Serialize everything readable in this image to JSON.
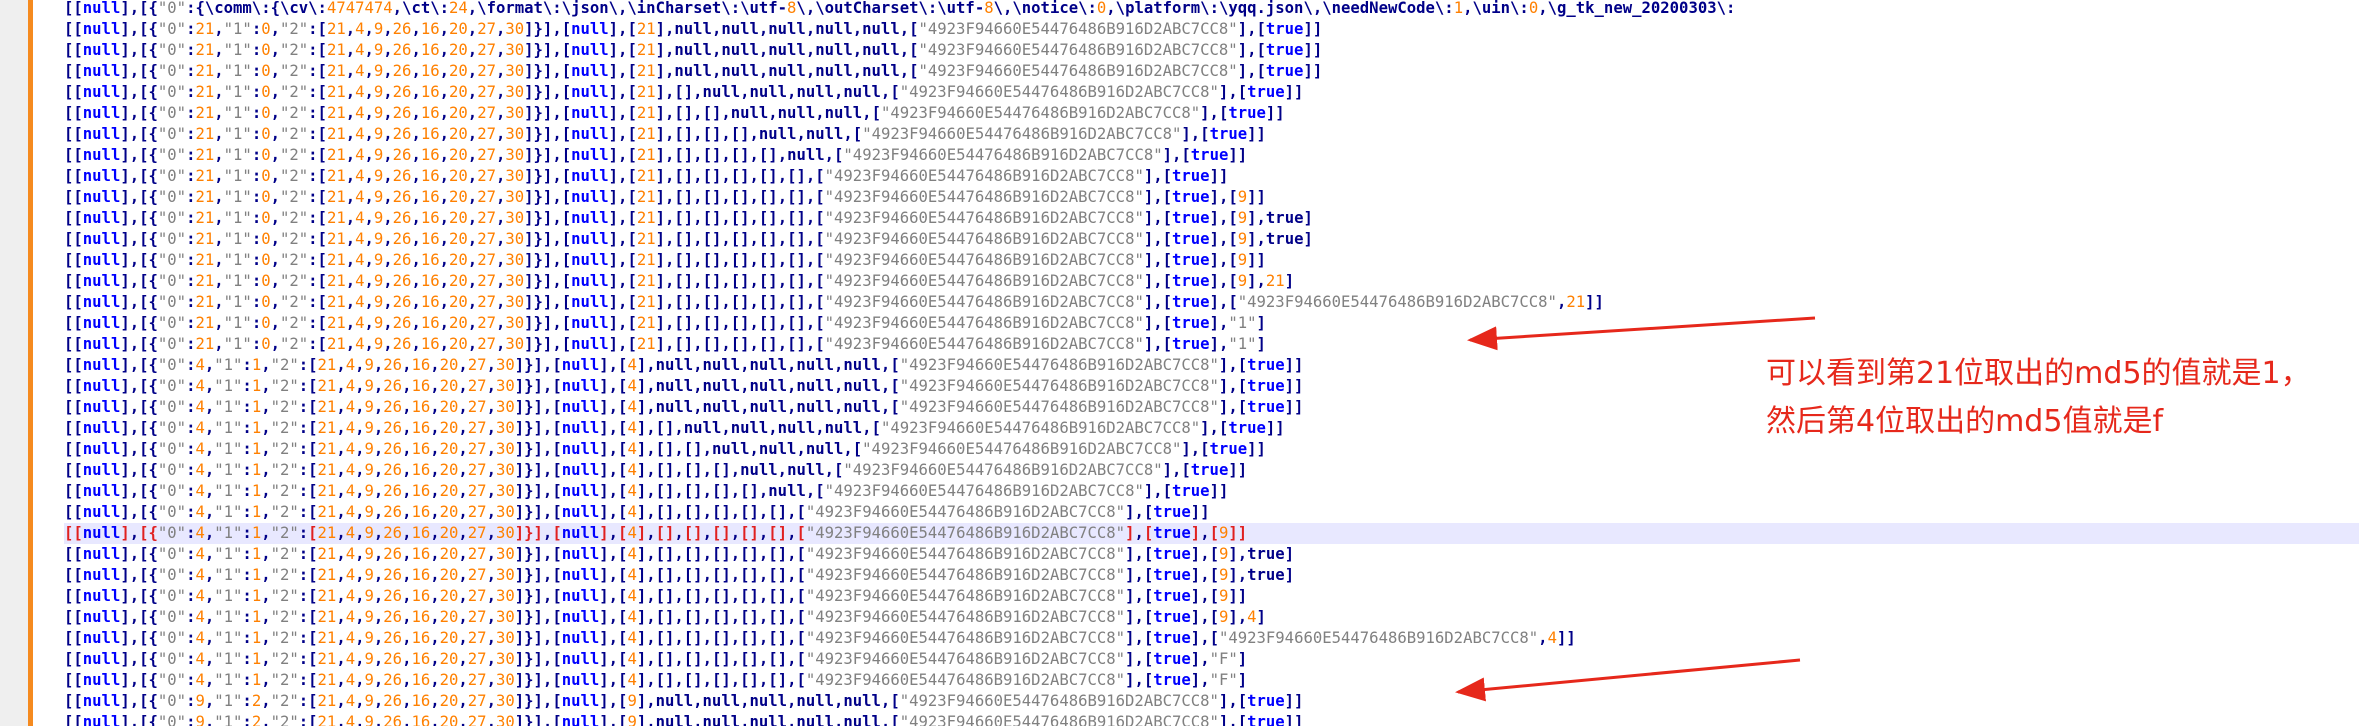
{
  "editor": {
    "lines": [
      "[[null],[{\"0\":\"{\\\"comm\\\":{\\\"cv\\\":4747474,\\\"ct\\\":24,\\\"format\\\":\\\"json\\\",\\\"inCharset\\\":\\\"utf-8\\\",\\\"outCharset\\\":\\\"utf-8\\\",\\\"notice\\\":0,\\\"platform\\\":\\\"yqq.json\\\",\\\"needNewCode\\\":1,\\\"uin\\\":0,\\\"g_tk_new_20200303\\\":",
      "[[null],[{\"0\":21,\"1\":0,\"2\":[21,4,9,26,16,20,27,30]}],[null],[21],null,null,null,null,null,[\"4923F94660E54476486B916D2ABC7CC8\"],[true]]",
      "[[null],[{\"0\":21,\"1\":0,\"2\":[21,4,9,26,16,20,27,30]}],[null],[21],null,null,null,null,null,[\"4923F94660E54476486B916D2ABC7CC8\"],[true]]",
      "[[null],[{\"0\":21,\"1\":0,\"2\":[21,4,9,26,16,20,27,30]}],[null],[21],null,null,null,null,null,[\"4923F94660E54476486B916D2ABC7CC8\"],[true]]",
      "[[null],[{\"0\":21,\"1\":0,\"2\":[21,4,9,26,16,20,27,30]}],[null],[21],[],null,null,null,null,[\"4923F94660E54476486B916D2ABC7CC8\"],[true]]",
      "[[null],[{\"0\":21,\"1\":0,\"2\":[21,4,9,26,16,20,27,30]}],[null],[21],[],[],null,null,null,[\"4923F94660E54476486B916D2ABC7CC8\"],[true]]",
      "[[null],[{\"0\":21,\"1\":0,\"2\":[21,4,9,26,16,20,27,30]}],[null],[21],[],[],[],null,null,[\"4923F94660E54476486B916D2ABC7CC8\"],[true]]",
      "[[null],[{\"0\":21,\"1\":0,\"2\":[21,4,9,26,16,20,27,30]}],[null],[21],[],[],[],[],null,[\"4923F94660E54476486B916D2ABC7CC8\"],[true]]",
      "[[null],[{\"0\":21,\"1\":0,\"2\":[21,4,9,26,16,20,27,30]}],[null],[21],[],[],[],[],[],[\"4923F94660E54476486B916D2ABC7CC8\"],[true]]",
      "[[null],[{\"0\":21,\"1\":0,\"2\":[21,4,9,26,16,20,27,30]}],[null],[21],[],[],[],[],[],[\"4923F94660E54476486B916D2ABC7CC8\"],[true],[9]]",
      "[[null],[{\"0\":21,\"1\":0,\"2\":[21,4,9,26,16,20,27,30]}],[null],[21],[],[],[],[],[],[\"4923F94660E54476486B916D2ABC7CC8\"],[true],[9],true]",
      "[[null],[{\"0\":21,\"1\":0,\"2\":[21,4,9,26,16,20,27,30]}],[null],[21],[],[],[],[],[],[\"4923F94660E54476486B916D2ABC7CC8\"],[true],[9],true]",
      "[[null],[{\"0\":21,\"1\":0,\"2\":[21,4,9,26,16,20,27,30]}],[null],[21],[],[],[],[],[],[\"4923F94660E54476486B916D2ABC7CC8\"],[true],[9]]",
      "[[null],[{\"0\":21,\"1\":0,\"2\":[21,4,9,26,16,20,27,30]}],[null],[21],[],[],[],[],[],[\"4923F94660E54476486B916D2ABC7CC8\"],[true],[9],21]",
      "[[null],[{\"0\":21,\"1\":0,\"2\":[21,4,9,26,16,20,27,30]}],[null],[21],[],[],[],[],[],[\"4923F94660E54476486B916D2ABC7CC8\"],[true],[\"4923F94660E54476486B916D2ABC7CC8\",21]]",
      "[[null],[{\"0\":21,\"1\":0,\"2\":[21,4,9,26,16,20,27,30]}],[null],[21],[],[],[],[],[],[\"4923F94660E54476486B916D2ABC7CC8\"],[true],\"1\"]",
      "[[null],[{\"0\":21,\"1\":0,\"2\":[21,4,9,26,16,20,27,30]}],[null],[21],[],[],[],[],[],[\"4923F94660E54476486B916D2ABC7CC8\"],[true],\"1\"]",
      "[[null],[{\"0\":4,\"1\":1,\"2\":[21,4,9,26,16,20,27,30]}],[null],[4],null,null,null,null,null,[\"4923F94660E54476486B916D2ABC7CC8\"],[true]]",
      "[[null],[{\"0\":4,\"1\":1,\"2\":[21,4,9,26,16,20,27,30]}],[null],[4],null,null,null,null,null,[\"4923F94660E54476486B916D2ABC7CC8\"],[true]]",
      "[[null],[{\"0\":4,\"1\":1,\"2\":[21,4,9,26,16,20,27,30]}],[null],[4],null,null,null,null,null,[\"4923F94660E54476486B916D2ABC7CC8\"],[true]]",
      "[[null],[{\"0\":4,\"1\":1,\"2\":[21,4,9,26,16,20,27,30]}],[null],[4],[],null,null,null,null,[\"4923F94660E54476486B916D2ABC7CC8\"],[true]]",
      "[[null],[{\"0\":4,\"1\":1,\"2\":[21,4,9,26,16,20,27,30]}],[null],[4],[],[],null,null,null,[\"4923F94660E54476486B916D2ABC7CC8\"],[true]]",
      "[[null],[{\"0\":4,\"1\":1,\"2\":[21,4,9,26,16,20,27,30]}],[null],[4],[],[],[],null,null,[\"4923F94660E54476486B916D2ABC7CC8\"],[true]]",
      "[[null],[{\"0\":4,\"1\":1,\"2\":[21,4,9,26,16,20,27,30]}],[null],[4],[],[],[],[],null,[\"4923F94660E54476486B916D2ABC7CC8\"],[true]]",
      "[[null],[{\"0\":4,\"1\":1,\"2\":[21,4,9,26,16,20,27,30]}],[null],[4],[],[],[],[],[],[\"4923F94660E54476486B916D2ABC7CC8\"],[true]]",
      "[[null],[{\"0\":4,\"1\":1,\"2\":[21,4,9,26,16,20,27,30]}],[null],[4],[],[],[],[],[],[\"4923F94660E54476486B916D2ABC7CC8\"],[true],[9]]",
      "[[null],[{\"0\":4,\"1\":1,\"2\":[21,4,9,26,16,20,27,30]}],[null],[4],[],[],[],[],[],[\"4923F94660E54476486B916D2ABC7CC8\"],[true],[9],true]",
      "[[null],[{\"0\":4,\"1\":1,\"2\":[21,4,9,26,16,20,27,30]}],[null],[4],[],[],[],[],[],[\"4923F94660E54476486B916D2ABC7CC8\"],[true],[9],true]",
      "[[null],[{\"0\":4,\"1\":1,\"2\":[21,4,9,26,16,20,27,30]}],[null],[4],[],[],[],[],[],[\"4923F94660E54476486B916D2ABC7CC8\"],[true],[9]]",
      "[[null],[{\"0\":4,\"1\":1,\"2\":[21,4,9,26,16,20,27,30]}],[null],[4],[],[],[],[],[],[\"4923F94660E54476486B916D2ABC7CC8\"],[true],[9],4]",
      "[[null],[{\"0\":4,\"1\":1,\"2\":[21,4,9,26,16,20,27,30]}],[null],[4],[],[],[],[],[],[\"4923F94660E54476486B916D2ABC7CC8\"],[true],[\"4923F94660E54476486B916D2ABC7CC8\",4]]",
      "[[null],[{\"0\":4,\"1\":1,\"2\":[21,4,9,26,16,20,27,30]}],[null],[4],[],[],[],[],[],[\"4923F94660E54476486B916D2ABC7CC8\"],[true],\"F\"]",
      "[[null],[{\"0\":4,\"1\":1,\"2\":[21,4,9,26,16,20,27,30]}],[null],[4],[],[],[],[],[],[\"4923F94660E54476486B916D2ABC7CC8\"],[true],\"F\"]",
      "[[null],[{\"0\":9,\"1\":2,\"2\":[21,4,9,26,16,20,27,30]}],[null],[9],null,null,null,null,null,[\"4923F94660E54476486B916D2ABC7CC8\"],[true]]",
      "[[null],[{\"0\":9,\"1\":2,\"2\":[21,4,9,26,16,20,27,30]}],[null],[9],null,null,null,null,null,[\"4923F94660E54476486B916D2ABC7CC8\"],[true]]"
    ],
    "current_line_index": 25
  },
  "annotation": {
    "line1": "可以看到第21位取出的md5的值就是1，",
    "line2": "然后第4位取出的md5值就是f"
  },
  "colors": {
    "bracket": "#000088",
    "keyword": "#0000ff",
    "string": "#808080",
    "number": "#ff8000",
    "annotation": "#e6281b",
    "current_line_bg": "#e8e8ff",
    "gutter_marker": "#f58a1f"
  }
}
